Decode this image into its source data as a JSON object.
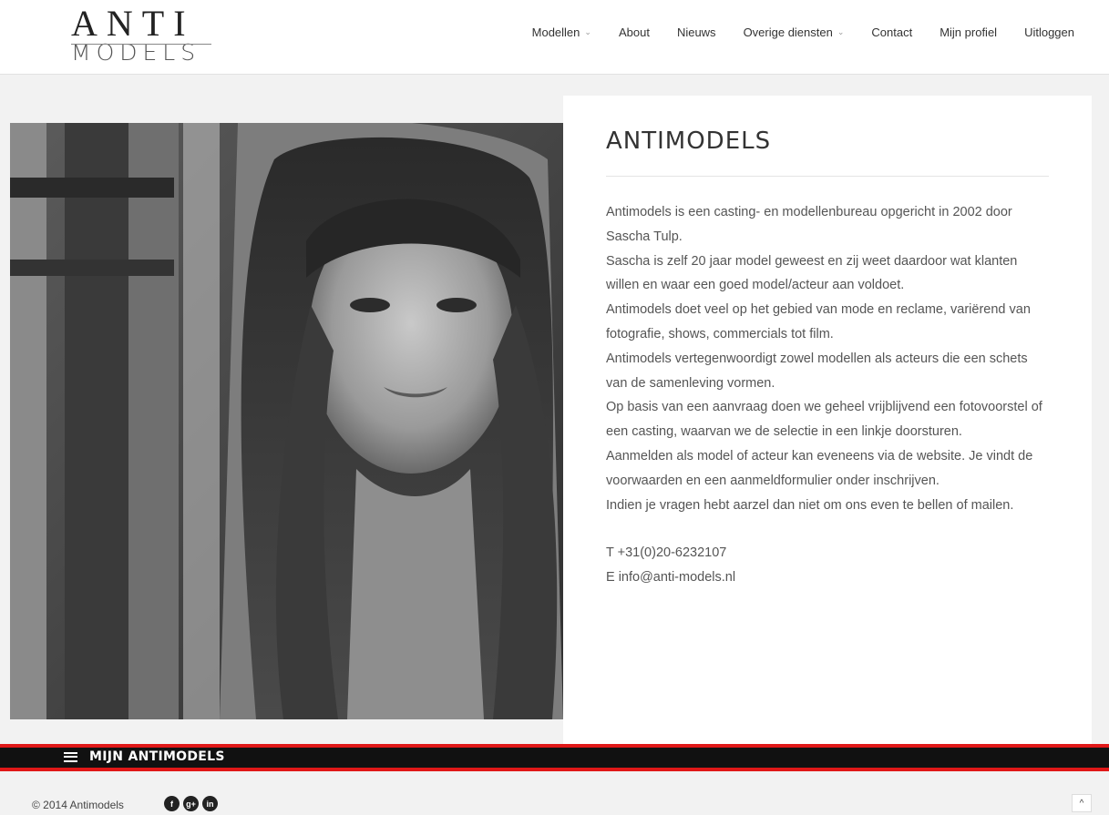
{
  "logo": {
    "top": "ANTI",
    "bottom": "MODELS"
  },
  "nav": [
    {
      "label": "Modellen",
      "dropdown": true
    },
    {
      "label": "About",
      "dropdown": false
    },
    {
      "label": "Nieuws",
      "dropdown": false
    },
    {
      "label": "Overige diensten",
      "dropdown": true
    },
    {
      "label": "Contact",
      "dropdown": false
    },
    {
      "label": "Mijn profiel",
      "dropdown": false
    },
    {
      "label": "Uitloggen",
      "dropdown": false
    }
  ],
  "content": {
    "title": "ANTIMODELS",
    "paragraphs": [
      "Antimodels is een casting- en modellenbureau opgericht in 2002 door Sascha Tulp.",
      "Sascha is zelf 20 jaar model geweest en zij weet daardoor wat klanten willen en waar een goed model/acteur aan voldoet.",
      "Antimodels doet veel op het gebied van mode en reclame, variërend van fotografie, shows, commercials tot film.",
      "Antimodels vertegenwoordigt zowel modellen als acteurs die een schets van de samenleving vormen.",
      "Op basis van een aanvraag doen we geheel vrijblijvend een fotovoorstel of een casting, waarvan we de selectie in een linkje doorsturen.",
      "Aanmelden als model of acteur kan eveneens via de website. Je vindt de voorwaarden en een aanmeldformulier onder inschrijven.",
      "Indien je vragen hebt aarzel dan niet om ons even te bellen of mailen."
    ],
    "phone": "T +31(0)20-6232107",
    "email": "E info@anti-models.nl"
  },
  "bottom_bar": {
    "label": "MIJN ANTIMODELS",
    "accent": "#e01818"
  },
  "footer": {
    "copyright": "© 2014 Antimodels",
    "social": [
      {
        "icon": "facebook-icon",
        "glyph": "f"
      },
      {
        "icon": "google-plus-icon",
        "glyph": "g+"
      },
      {
        "icon": "linkedin-icon",
        "glyph": "in"
      }
    ],
    "to_top": "^"
  }
}
